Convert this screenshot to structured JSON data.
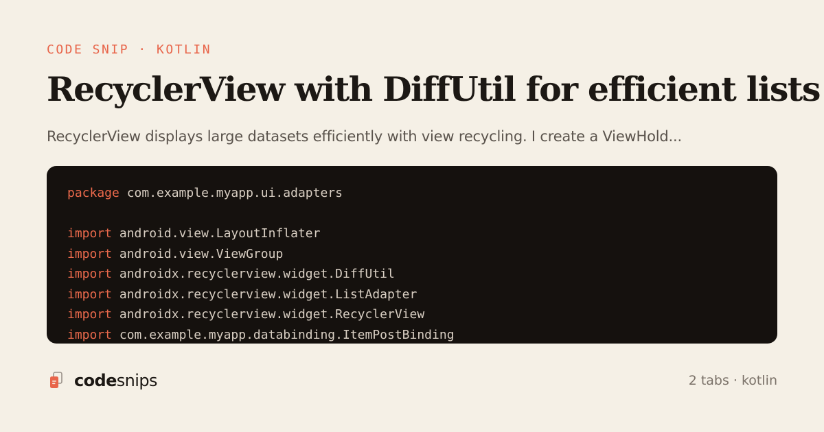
{
  "eyebrow": "CODE SNIP · KOTLIN",
  "title": "RecyclerView with DiffUtil for efficient lists",
  "subtitle": "RecyclerView displays large datasets efficiently with view recycling. I create a ViewHold...",
  "code": {
    "lines": [
      {
        "keyword": "package",
        "text": " com.example.myapp.ui.adapters"
      },
      {
        "keyword": "",
        "text": ""
      },
      {
        "keyword": "import",
        "text": " android.view.LayoutInflater"
      },
      {
        "keyword": "import",
        "text": " android.view.ViewGroup"
      },
      {
        "keyword": "import",
        "text": " androidx.recyclerview.widget.DiffUtil"
      },
      {
        "keyword": "import",
        "text": " androidx.recyclerview.widget.ListAdapter"
      },
      {
        "keyword": "import",
        "text": " androidx.recyclerview.widget.RecyclerView"
      },
      {
        "keyword": "import",
        "text": " com.example.myapp.databinding.ItemPostBinding"
      }
    ]
  },
  "brand": {
    "name_bold": "code",
    "name_regular": "snips",
    "icon": "snippet-cards-icon",
    "accent_color": "#e8654a"
  },
  "meta": "2 tabs · kotlin",
  "colors": {
    "background": "#f5f0e6",
    "code_background": "#15110e",
    "keyword": "#ec6a4c",
    "code_text": "#d9cfc3",
    "title": "#1c1814"
  }
}
